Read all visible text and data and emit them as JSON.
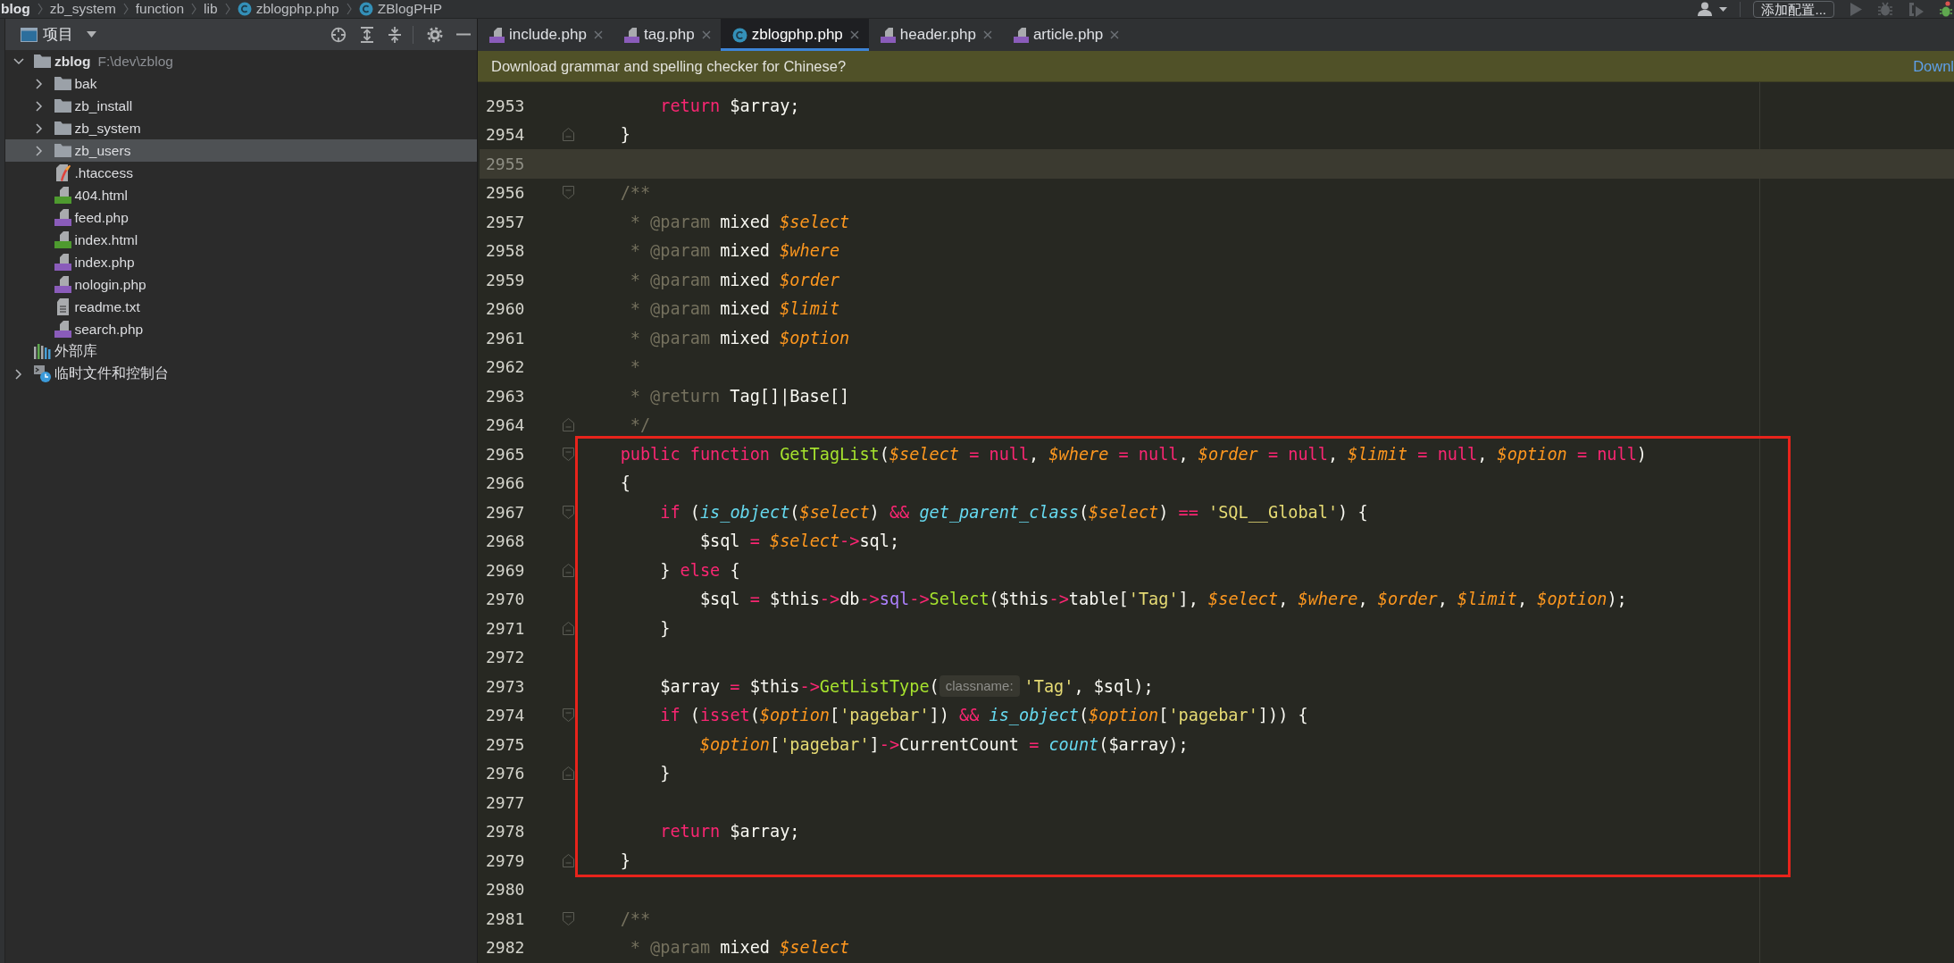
{
  "breadcrumb": [
    {
      "label": "blog",
      "kind": "root"
    },
    {
      "label": "zb_system",
      "kind": "folder"
    },
    {
      "label": "function",
      "kind": "folder"
    },
    {
      "label": "lib",
      "kind": "folder"
    },
    {
      "label": "zblogphp.php",
      "kind": "class"
    },
    {
      "label": "ZBlogPHP",
      "kind": "class"
    }
  ],
  "toolbar": {
    "config_button": "添加配置..."
  },
  "sidebar": {
    "title": "项目",
    "tree": [
      {
        "label": "zblog",
        "path": "F:\\dev\\zblog",
        "kind": "module",
        "expanded": true,
        "selected": false,
        "children": [
          {
            "label": "bak",
            "kind": "folder",
            "expanded": false,
            "selected": false
          },
          {
            "label": "zb_install",
            "kind": "folder",
            "expanded": false,
            "selected": false
          },
          {
            "label": "zb_system",
            "kind": "folder",
            "expanded": false,
            "selected": false
          },
          {
            "label": "zb_users",
            "kind": "folder",
            "expanded": false,
            "selected": true
          },
          {
            "label": ".htaccess",
            "kind": "htaccess",
            "selected": false
          },
          {
            "label": "404.html",
            "kind": "html",
            "selected": false
          },
          {
            "label": "feed.php",
            "kind": "php",
            "selected": false
          },
          {
            "label": "index.html",
            "kind": "html",
            "selected": false
          },
          {
            "label": "index.php",
            "kind": "php",
            "selected": false
          },
          {
            "label": "nologin.php",
            "kind": "php",
            "selected": false
          },
          {
            "label": "readme.txt",
            "kind": "text",
            "selected": false
          },
          {
            "label": "search.php",
            "kind": "php",
            "selected": false
          }
        ]
      },
      {
        "label": "外部库",
        "kind": "library",
        "selected": false
      },
      {
        "label": "临时文件和控制台",
        "kind": "scratches",
        "expanded": false,
        "selected": false
      }
    ]
  },
  "tabs": [
    {
      "label": "include.php",
      "kind": "php",
      "selected": false
    },
    {
      "label": "tag.php",
      "kind": "php",
      "selected": false
    },
    {
      "label": "zblogphp.php",
      "kind": "class",
      "selected": true
    },
    {
      "label": "header.php",
      "kind": "php",
      "selected": false
    },
    {
      "label": "article.php",
      "kind": "php",
      "selected": false
    }
  ],
  "banner": {
    "message": "Download grammar and spelling checker for Chinese?",
    "action": "Downl"
  },
  "editor": {
    "sections": [
      {
        "boxed": false,
        "lines": [
          {
            "number": "2953",
            "kind": "line",
            "current": false,
            "tokens": [
              {
                "kind": "keyword",
                "text": "        return"
              },
              {
                "kind": "plain",
                "text": " $array;"
              }
            ]
          },
          {
            "number": "2954",
            "kind": "fold_end",
            "current": false,
            "tokens": [
              {
                "kind": "plain",
                "text": "    }"
              }
            ]
          },
          {
            "number": "2955",
            "kind": "line",
            "current": true
          },
          {
            "number": "2956",
            "kind": "fold_start",
            "current": false,
            "tokens": [
              {
                "kind": "comment",
                "text": "    /**"
              }
            ]
          },
          {
            "number": "2957",
            "kind": "line",
            "current": false,
            "tokens": [
              {
                "kind": "comment",
                "text": "     * @param"
              },
              {
                "kind": "plain",
                "text": " mixed "
              },
              {
                "kind": "variable",
                "text": "$select"
              }
            ]
          },
          {
            "number": "2958",
            "kind": "line",
            "current": false,
            "tokens": [
              {
                "kind": "comment",
                "text": "     * @param"
              },
              {
                "kind": "plain",
                "text": " mixed "
              },
              {
                "kind": "variable",
                "text": "$where"
              }
            ]
          },
          {
            "number": "2959",
            "kind": "line",
            "current": false,
            "tokens": [
              {
                "kind": "comment",
                "text": "     * @param"
              },
              {
                "kind": "plain",
                "text": " mixed "
              },
              {
                "kind": "variable",
                "text": "$order"
              }
            ]
          },
          {
            "number": "2960",
            "kind": "line",
            "current": false,
            "tokens": [
              {
                "kind": "comment",
                "text": "     * @param"
              },
              {
                "kind": "plain",
                "text": " mixed "
              },
              {
                "kind": "variable",
                "text": "$limit"
              }
            ]
          },
          {
            "number": "2961",
            "kind": "line",
            "current": false,
            "tokens": [
              {
                "kind": "comment",
                "text": "     * @param"
              },
              {
                "kind": "plain",
                "text": " mixed "
              },
              {
                "kind": "variable",
                "text": "$option"
              }
            ]
          },
          {
            "number": "2962",
            "kind": "line",
            "current": false,
            "tokens": [
              {
                "kind": "comment",
                "text": "     *"
              }
            ]
          },
          {
            "number": "2963",
            "kind": "line",
            "current": false,
            "tokens": [
              {
                "kind": "comment",
                "text": "     * @return"
              },
              {
                "kind": "plain",
                "text": " Tag[]|Base[]"
              }
            ]
          },
          {
            "number": "2964",
            "kind": "fold_end",
            "current": false,
            "tokens": [
              {
                "kind": "comment",
                "text": "     */"
              }
            ]
          }
        ]
      },
      {
        "boxed": true,
        "lines": [
          {
            "number": "2965",
            "kind": "fold_start",
            "current": false,
            "tokens": [
              {
                "kind": "keyword",
                "text": "    public function "
              },
              {
                "kind": "function",
                "text": "GetTagList"
              },
              {
                "kind": "plain",
                "text": "("
              },
              {
                "kind": "variable",
                "text": "$select"
              },
              {
                "kind": "keyword",
                "text": " = null"
              },
              {
                "kind": "plain",
                "text": ", "
              },
              {
                "kind": "variable",
                "text": "$where"
              },
              {
                "kind": "keyword",
                "text": " = null"
              },
              {
                "kind": "plain",
                "text": ", "
              },
              {
                "kind": "variable",
                "text": "$order"
              },
              {
                "kind": "keyword",
                "text": " = null"
              },
              {
                "kind": "plain",
                "text": ", "
              },
              {
                "kind": "variable",
                "text": "$limit"
              },
              {
                "kind": "keyword",
                "text": " = null"
              },
              {
                "kind": "plain",
                "text": ", "
              },
              {
                "kind": "variable",
                "text": "$option"
              },
              {
                "kind": "keyword",
                "text": " = null"
              },
              {
                "kind": "plain",
                "text": ")"
              }
            ]
          },
          {
            "number": "2966",
            "kind": "line",
            "current": false,
            "tokens": [
              {
                "kind": "plain",
                "text": "    {"
              }
            ]
          },
          {
            "number": "2967",
            "kind": "fold_start",
            "current": false,
            "tokens": [
              {
                "kind": "keyword",
                "text": "        if"
              },
              {
                "kind": "plain",
                "text": " ("
              },
              {
                "kind": "builtin",
                "text": "is_object"
              },
              {
                "kind": "plain",
                "text": "("
              },
              {
                "kind": "variable",
                "text": "$select"
              },
              {
                "kind": "plain",
                "text": ") "
              },
              {
                "kind": "keyword",
                "text": "&& "
              },
              {
                "kind": "builtin",
                "text": "get_parent_class"
              },
              {
                "kind": "plain",
                "text": "("
              },
              {
                "kind": "variable",
                "text": "$select"
              },
              {
                "kind": "plain",
                "text": ") "
              },
              {
                "kind": "keyword",
                "text": "== "
              },
              {
                "kind": "string",
                "text": "'SQL__Global'"
              },
              {
                "kind": "plain",
                "text": ") {"
              }
            ]
          },
          {
            "number": "2968",
            "kind": "line",
            "current": false,
            "tokens": [
              {
                "kind": "plain",
                "text": "            $sql "
              },
              {
                "kind": "keyword",
                "text": "= "
              },
              {
                "kind": "variable",
                "text": "$select"
              },
              {
                "kind": "keyword",
                "text": "->"
              },
              {
                "kind": "plain",
                "text": "sql;"
              }
            ]
          },
          {
            "number": "2969",
            "kind": "fold_end",
            "current": false,
            "tokens": [
              {
                "kind": "plain",
                "text": "        } "
              },
              {
                "kind": "keyword",
                "text": "else"
              },
              {
                "kind": "plain",
                "text": " {"
              }
            ]
          },
          {
            "number": "2970",
            "kind": "line",
            "current": false,
            "tokens": [
              {
                "kind": "plain",
                "text": "            $sql "
              },
              {
                "kind": "keyword",
                "text": "="
              },
              {
                "kind": "plain",
                "text": " $this"
              },
              {
                "kind": "keyword",
                "text": "->"
              },
              {
                "kind": "plain",
                "text": "db"
              },
              {
                "kind": "keyword",
                "text": "->"
              },
              {
                "kind": "property",
                "text": "sql"
              },
              {
                "kind": "keyword",
                "text": "->"
              },
              {
                "kind": "function",
                "text": "Select"
              },
              {
                "kind": "plain",
                "text": "($this"
              },
              {
                "kind": "keyword",
                "text": "->"
              },
              {
                "kind": "plain",
                "text": "table["
              },
              {
                "kind": "string",
                "text": "'Tag'"
              },
              {
                "kind": "plain",
                "text": "], "
              },
              {
                "kind": "variable",
                "text": "$select"
              },
              {
                "kind": "plain",
                "text": ", "
              },
              {
                "kind": "variable",
                "text": "$where"
              },
              {
                "kind": "plain",
                "text": ", "
              },
              {
                "kind": "variable",
                "text": "$order"
              },
              {
                "kind": "plain",
                "text": ", "
              },
              {
                "kind": "variable",
                "text": "$limit"
              },
              {
                "kind": "plain",
                "text": ", "
              },
              {
                "kind": "variable",
                "text": "$option"
              },
              {
                "kind": "plain",
                "text": ");"
              }
            ]
          },
          {
            "number": "2971",
            "kind": "fold_end",
            "current": false,
            "tokens": [
              {
                "kind": "plain",
                "text": "        }"
              }
            ]
          },
          {
            "number": "2972",
            "kind": "line",
            "current": false
          },
          {
            "number": "2973",
            "kind": "line",
            "current": false,
            "tokens": [
              {
                "kind": "plain",
                "text": "        $array "
              },
              {
                "kind": "keyword",
                "text": "="
              },
              {
                "kind": "plain",
                "text": " $this"
              },
              {
                "kind": "keyword",
                "text": "->"
              },
              {
                "kind": "function",
                "text": "GetListType"
              },
              {
                "kind": "plain",
                "text": "("
              },
              {
                "kind": "hint",
                "text": "classname:"
              },
              {
                "kind": "string",
                "text": "'Tag'"
              },
              {
                "kind": "plain",
                "text": ", $sql);"
              }
            ]
          },
          {
            "number": "2974",
            "kind": "fold_start",
            "current": false,
            "tokens": [
              {
                "kind": "keyword",
                "text": "        if"
              },
              {
                "kind": "plain",
                "text": " ("
              },
              {
                "kind": "keyword",
                "text": "isset"
              },
              {
                "kind": "plain",
                "text": "("
              },
              {
                "kind": "variable",
                "text": "$option"
              },
              {
                "kind": "plain",
                "text": "["
              },
              {
                "kind": "string",
                "text": "'pagebar'"
              },
              {
                "kind": "plain",
                "text": "]) "
              },
              {
                "kind": "keyword",
                "text": "&& "
              },
              {
                "kind": "builtin",
                "text": "is_object"
              },
              {
                "kind": "plain",
                "text": "("
              },
              {
                "kind": "variable",
                "text": "$option"
              },
              {
                "kind": "plain",
                "text": "["
              },
              {
                "kind": "string",
                "text": "'pagebar'"
              },
              {
                "kind": "plain",
                "text": "])) {"
              }
            ]
          },
          {
            "number": "2975",
            "kind": "line",
            "current": false,
            "tokens": [
              {
                "kind": "variable",
                "text": "            $option"
              },
              {
                "kind": "plain",
                "text": "["
              },
              {
                "kind": "string",
                "text": "'pagebar'"
              },
              {
                "kind": "plain",
                "text": "]"
              },
              {
                "kind": "keyword",
                "text": "->"
              },
              {
                "kind": "plain",
                "text": "CurrentCount "
              },
              {
                "kind": "keyword",
                "text": "= "
              },
              {
                "kind": "builtin",
                "text": "count"
              },
              {
                "kind": "plain",
                "text": "($array);"
              }
            ]
          },
          {
            "number": "2976",
            "kind": "fold_end",
            "current": false,
            "tokens": [
              {
                "kind": "plain",
                "text": "        }"
              }
            ]
          },
          {
            "number": "2977",
            "kind": "line",
            "current": false
          },
          {
            "number": "2978",
            "kind": "line",
            "current": false,
            "tokens": [
              {
                "kind": "keyword",
                "text": "        return"
              },
              {
                "kind": "plain",
                "text": " $array;"
              }
            ]
          },
          {
            "number": "2979",
            "kind": "fold_end",
            "current": false,
            "tokens": [
              {
                "kind": "plain",
                "text": "    }"
              }
            ]
          }
        ]
      },
      {
        "boxed": false,
        "lines": [
          {
            "number": "2980",
            "kind": "line",
            "current": false
          },
          {
            "number": "2981",
            "kind": "fold_start",
            "current": false,
            "tokens": [
              {
                "kind": "comment",
                "text": "    /**"
              }
            ]
          },
          {
            "number": "2982",
            "kind": "line",
            "current": false,
            "tokens": [
              {
                "kind": "comment",
                "text": "     * @param"
              },
              {
                "kind": "plain",
                "text": " mixed "
              },
              {
                "kind": "variable",
                "text": "$select"
              }
            ]
          }
        ]
      }
    ]
  }
}
